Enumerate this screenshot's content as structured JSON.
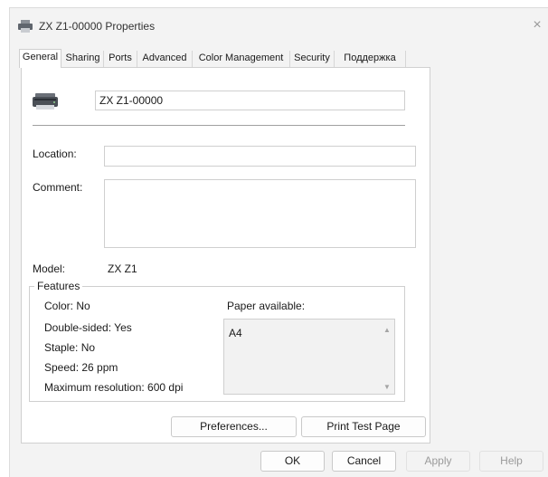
{
  "window": {
    "title": "ZX Z1-00000 Properties",
    "close_glyph": "×"
  },
  "tabs": [
    {
      "label": "General",
      "active": true
    },
    {
      "label": "Sharing"
    },
    {
      "label": "Ports"
    },
    {
      "label": "Advanced"
    },
    {
      "label": "Color Management"
    },
    {
      "label": "Security"
    },
    {
      "label": "Поддержка"
    }
  ],
  "general": {
    "printer_name": "ZX Z1-00000",
    "location_label": "Location:",
    "location_value": "",
    "comment_label": "Comment:",
    "comment_value": "",
    "model_label": "Model:",
    "model_value": "ZX Z1"
  },
  "features": {
    "legend": "Features",
    "color": "Color: No",
    "double_sided": "Double-sided: Yes",
    "staple": "Staple: No",
    "speed": "Speed: 26 ppm",
    "max_resolution": "Maximum resolution: 600 dpi",
    "paper_label": "Paper available:",
    "paper_items": [
      "A4"
    ]
  },
  "buttons": {
    "preferences": "Preferences...",
    "print_test_page": "Print Test Page",
    "ok": "OK",
    "cancel": "Cancel",
    "apply": "Apply",
    "help": "Help"
  },
  "icons": {
    "title_icon": "printer-icon",
    "panel_icon": "printer-icon"
  }
}
